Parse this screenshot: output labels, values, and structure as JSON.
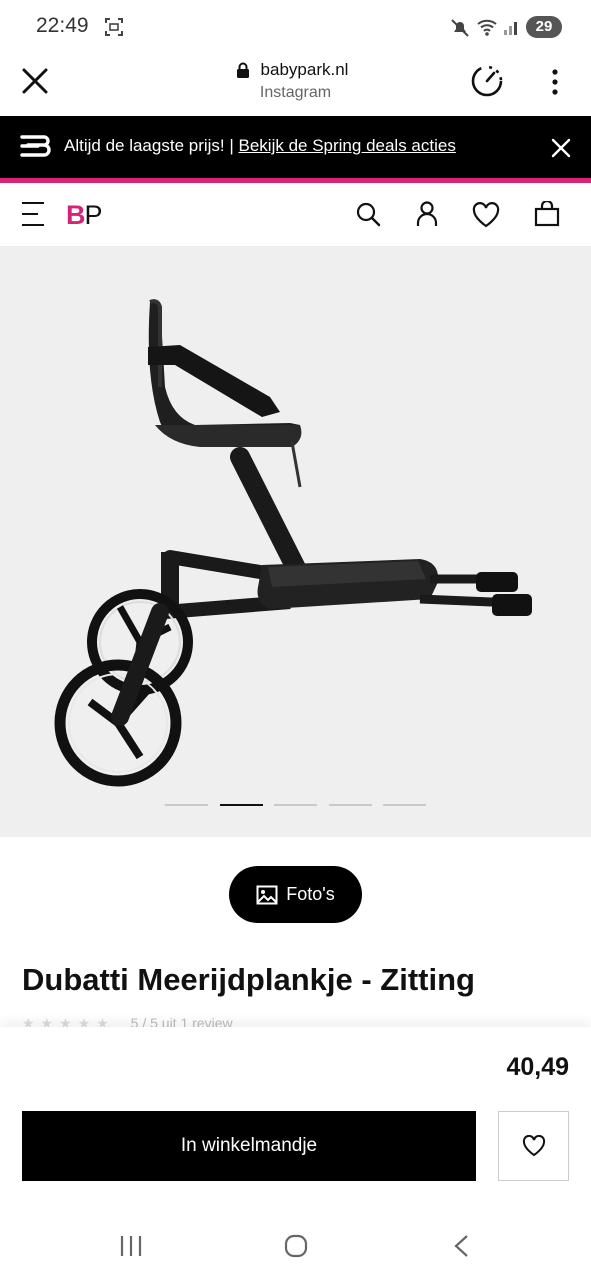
{
  "status_bar": {
    "time": "22:49",
    "battery": "29",
    "icons": [
      "screenshot-icon",
      "mute-icon",
      "wifi-icon",
      "signal-icon",
      "battery-icon"
    ]
  },
  "browser": {
    "domain": "babypark.nl",
    "source": "Instagram",
    "icons": [
      "close-icon",
      "lock-icon",
      "speed-icon",
      "more-vert-icon"
    ]
  },
  "promo": {
    "text": "Altijd de laagste prijs! | ",
    "link": "Bekijk de Spring deals acties",
    "accent_color": "#d6237a",
    "icons": [
      "promo-logo-icon",
      "close-icon"
    ]
  },
  "site_header": {
    "logo_b": "B",
    "logo_p": "P",
    "logo_color": "#d6237a",
    "icons": [
      "menu-icon",
      "search-icon",
      "account-icon",
      "heart-icon",
      "bag-icon"
    ]
  },
  "gallery": {
    "slide_count": 5,
    "active_slide": 2,
    "photos_label": "Foto's"
  },
  "product": {
    "title": "Dubatti Meerijdplankje - Zitting",
    "rating_text": "5 / 5 uit 1 review",
    "price": "40,49",
    "cart_label": "In winkelmandje"
  }
}
